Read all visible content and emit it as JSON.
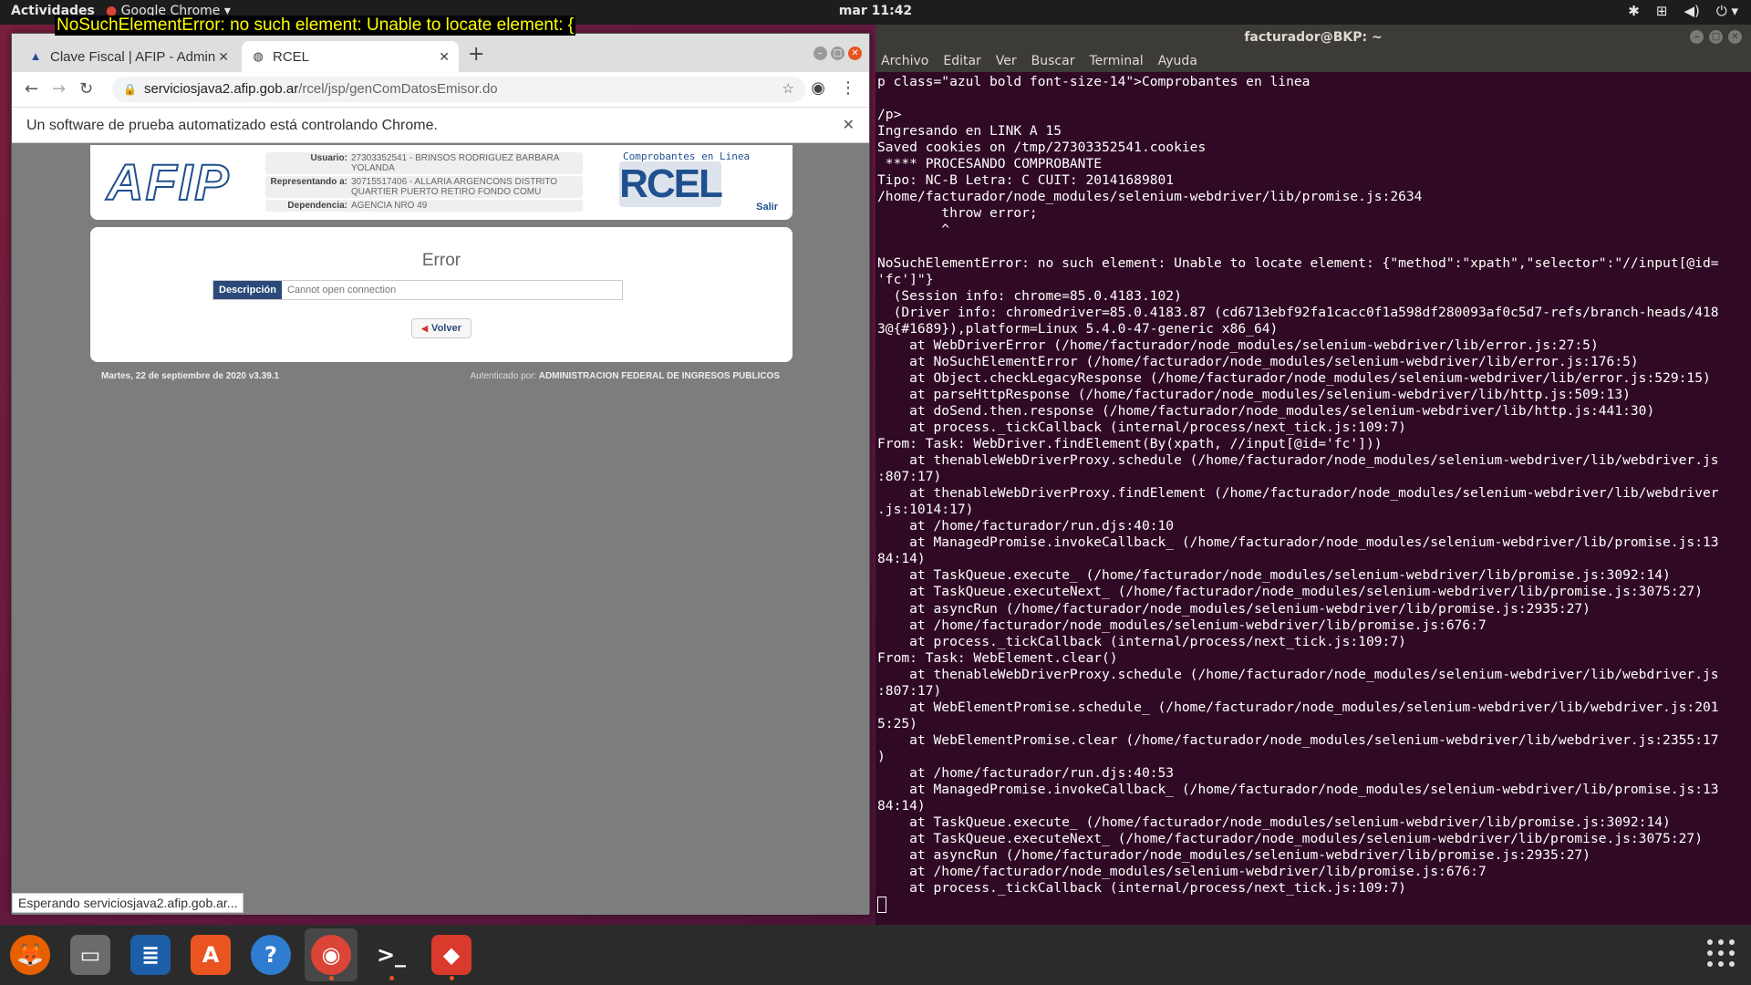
{
  "topbar": {
    "activities": "Actividades",
    "app_menu": "Google Chrome ▾",
    "clock": "mar 11:42"
  },
  "notification": "NoSuchElementError: no such element: Unable to locate element: {",
  "chrome": {
    "tabs": [
      {
        "title": "Clave Fiscal | AFIP - Admin"
      },
      {
        "title": "RCEL"
      }
    ],
    "url_host": "serviciosjava2.afip.gob.ar",
    "url_path": "/rcel/jsp/genComDatosEmisor.do",
    "infobar": "Un software de prueba automatizado está controlando Chrome.",
    "status": "Esperando serviciosjava2.afip.gob.ar..."
  },
  "afip": {
    "logo": "AFIP",
    "usuario_label": "Usuario:",
    "usuario": "27303352541 - BRINSOS RODRIGUEZ BARBARA YOLANDA",
    "representando_label": "Representando a:",
    "representando": "30715517406 - ALLARIA ARGENCONS DISTRITO QUARTIER PUERTO RETIRO FONDO COMU",
    "dependencia_label": "Dependencia:",
    "dependencia": "AGENCIA NRO 49",
    "rcel_caption": "Comprobantes en Linea",
    "rcel_logo": "RCEL",
    "salir": "Salir",
    "error_title": "Error",
    "desc_label": "Descripción",
    "desc_value": "Cannot open connection",
    "volver": "Volver",
    "footer_left": "Martes, 22 de septiembre de 2020 v3.39.1",
    "footer_right_prefix": "Autenticado por:",
    "footer_right": "ADMINISTRACION FEDERAL DE INGRESOS PUBLICOS"
  },
  "terminal": {
    "title": "facturador@BKP: ~",
    "menu": [
      "Archivo",
      "Editar",
      "Ver",
      "Buscar",
      "Terminal",
      "Ayuda"
    ],
    "lines": [
      "p class=\"azul bold font-size-14\">Comprobantes en linea",
      "                                                                                                                          <",
      "/p>",
      "Ingresando en LINK A 15",
      "Saved cookies on /tmp/27303352541.cookies",
      " **** PROCESANDO COMPROBANTE",
      "Tipo: NC-B Letra: C CUIT: 20141689801",
      "/home/facturador/node_modules/selenium-webdriver/lib/promise.js:2634",
      "        throw error;",
      "        ^",
      "",
      "NoSuchElementError: no such element: Unable to locate element: {\"method\":\"xpath\",\"selector\":\"//input[@id=",
      "'fc']\"}",
      "  (Session info: chrome=85.0.4183.102)",
      "  (Driver info: chromedriver=85.0.4183.87 (cd6713ebf92fa1cacc0f1a598df280093af0c5d7-refs/branch-heads/418",
      "3@{#1689}),platform=Linux 5.4.0-47-generic x86_64)",
      "    at WebDriverError (/home/facturador/node_modules/selenium-webdriver/lib/error.js:27:5)",
      "    at NoSuchElementError (/home/facturador/node_modules/selenium-webdriver/lib/error.js:176:5)",
      "    at Object.checkLegacyResponse (/home/facturador/node_modules/selenium-webdriver/lib/error.js:529:15)",
      "    at parseHttpResponse (/home/facturador/node_modules/selenium-webdriver/lib/http.js:509:13)",
      "    at doSend.then.response (/home/facturador/node_modules/selenium-webdriver/lib/http.js:441:30)",
      "    at process._tickCallback (internal/process/next_tick.js:109:7)",
      "From: Task: WebDriver.findElement(By(xpath, //input[@id='fc']))",
      "    at thenableWebDriverProxy.schedule (/home/facturador/node_modules/selenium-webdriver/lib/webdriver.js",
      ":807:17)",
      "    at thenableWebDriverProxy.findElement (/home/facturador/node_modules/selenium-webdriver/lib/webdriver",
      ".js:1014:17)",
      "    at /home/facturador/run.djs:40:10",
      "    at ManagedPromise.invokeCallback_ (/home/facturador/node_modules/selenium-webdriver/lib/promise.js:13",
      "84:14)",
      "    at TaskQueue.execute_ (/home/facturador/node_modules/selenium-webdriver/lib/promise.js:3092:14)",
      "    at TaskQueue.executeNext_ (/home/facturador/node_modules/selenium-webdriver/lib/promise.js:3075:27)",
      "    at asyncRun (/home/facturador/node_modules/selenium-webdriver/lib/promise.js:2935:27)",
      "    at /home/facturador/node_modules/selenium-webdriver/lib/promise.js:676:7",
      "    at process._tickCallback (internal/process/next_tick.js:109:7)",
      "From: Task: WebElement.clear()",
      "    at thenableWebDriverProxy.schedule (/home/facturador/node_modules/selenium-webdriver/lib/webdriver.js",
      ":807:17)",
      "    at WebElementPromise.schedule_ (/home/facturador/node_modules/selenium-webdriver/lib/webdriver.js:201",
      "5:25)",
      "    at WebElementPromise.clear (/home/facturador/node_modules/selenium-webdriver/lib/webdriver.js:2355:17",
      ")",
      "    at /home/facturador/run.djs:40:53",
      "    at ManagedPromise.invokeCallback_ (/home/facturador/node_modules/selenium-webdriver/lib/promise.js:13",
      "84:14)",
      "    at TaskQueue.execute_ (/home/facturador/node_modules/selenium-webdriver/lib/promise.js:3092:14)",
      "    at TaskQueue.executeNext_ (/home/facturador/node_modules/selenium-webdriver/lib/promise.js:3075:27)",
      "    at asyncRun (/home/facturador/node_modules/selenium-webdriver/lib/promise.js:2935:27)",
      "    at /home/facturador/node_modules/selenium-webdriver/lib/promise.js:676:7",
      "    at process._tickCallback (internal/process/next_tick.js:109:7)"
    ]
  },
  "dock": [
    {
      "name": "firefox-icon",
      "glyph": "🦊",
      "color": "#e66000",
      "running": false
    },
    {
      "name": "files-icon",
      "glyph": "▭",
      "color": "#6b6b6b",
      "running": false
    },
    {
      "name": "writer-icon",
      "glyph": "≣",
      "color": "#1c5ea8",
      "running": false
    },
    {
      "name": "software-icon",
      "glyph": "A",
      "color": "#e95420",
      "running": false
    },
    {
      "name": "help-icon",
      "glyph": "?",
      "color": "#2f7dd1",
      "running": false
    },
    {
      "name": "chrome-icon",
      "glyph": "◉",
      "color": "#db4437",
      "running": true
    },
    {
      "name": "terminal-icon",
      "glyph": ">_",
      "color": "#2c2c2c",
      "running": true
    },
    {
      "name": "git-app-icon",
      "glyph": "◆",
      "color": "#d93a2b",
      "running": true
    }
  ],
  "colors": {
    "accent": "#e95420",
    "terminal_bg": "#300a24",
    "afip_blue": "#1f4f8f"
  }
}
